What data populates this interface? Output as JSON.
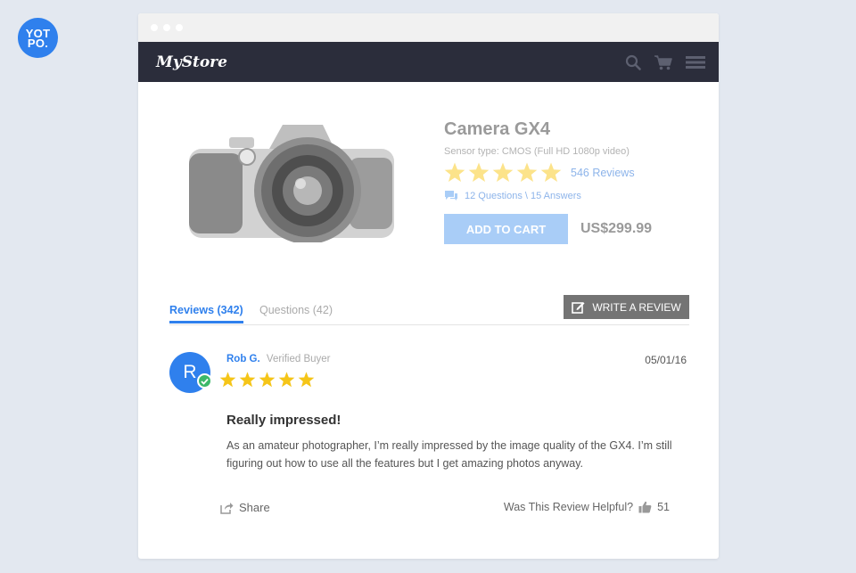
{
  "logo": {
    "line1": "YOT",
    "line2": "PO."
  },
  "store": {
    "brand": "MyStore"
  },
  "nav": {
    "icons": [
      "search-icon",
      "cart-icon",
      "menu-icon"
    ]
  },
  "product": {
    "title": "Camera GX4",
    "sensor": "Sensor type: CMOS (Full HD 1080p video)",
    "rating_stars": 5,
    "reviews_link": "546 Reviews",
    "qa_link": "12 Questions \\ 15 Answers",
    "add_to_cart": "ADD TO CART",
    "price": "US$299.99"
  },
  "tabs": [
    {
      "label": "Reviews (342)",
      "active": true
    },
    {
      "label": "Questions (42)",
      "active": false
    }
  ],
  "write_review": "WRITE A REVIEW",
  "review": {
    "avatar_initial": "R",
    "name": "Rob G.",
    "verified": "Verified Buyer",
    "date": "05/01/16",
    "stars": 5,
    "title": "Really impressed!",
    "body": "As an amateur photographer, I’m really impressed by the image quality of the GX4. I’m still figuring out how to use all the features but I get amazing photos anyway.",
    "share": "Share",
    "helpful_question": "Was This Review Helpful?",
    "helpful_count": "51"
  },
  "colors": {
    "accent": "#2f80ed",
    "navbar": "#2b2d3b",
    "star": "#f5c518",
    "star_faded": "#fce38a",
    "verified": "#3cb86a",
    "button_gray": "#747474",
    "cart_button": "#a9cdf7"
  }
}
